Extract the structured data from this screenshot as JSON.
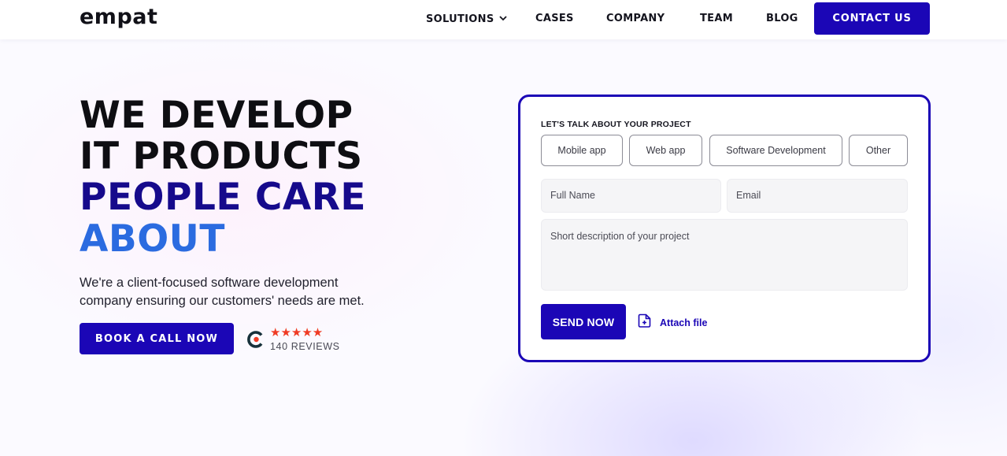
{
  "brand": {
    "logo_text": "empat"
  },
  "nav": {
    "items": [
      {
        "label": "SOLUTIONS",
        "has_dropdown": true
      },
      {
        "label": "CASES"
      },
      {
        "label": "COMPANY"
      },
      {
        "label": "TEAM"
      },
      {
        "label": "BLOG"
      }
    ],
    "contact_label": "CONTACT US"
  },
  "hero": {
    "line1": "WE DEVELOP",
    "line2": "IT PRODUCTS",
    "line3": "PEOPLE CARE",
    "line4": "ABOUT",
    "subtitle": "We're a client-focused software development company ensuring our customers' needs are met.",
    "cta_label": "BOOK A CALL NOW",
    "rating": {
      "stars": 5,
      "stars_text": "★★★★★",
      "reviews_label": "140 REVIEWS"
    }
  },
  "form": {
    "title": "LET'S TALK ABOUT YOUR PROJECT",
    "project_types": [
      "Mobile app",
      "Web app",
      "Software Development",
      "Other"
    ],
    "name_placeholder": "Full Name",
    "email_placeholder": "Email",
    "description_placeholder": "Short description of your project",
    "send_label": "SEND NOW",
    "attach_label": "Attach file"
  },
  "colors": {
    "primary": "#1b06b6",
    "hero_dark": "#0e0e12",
    "hero_navy": "#160a8c",
    "hero_blue": "#2b6be0",
    "star": "#ef3b24"
  }
}
